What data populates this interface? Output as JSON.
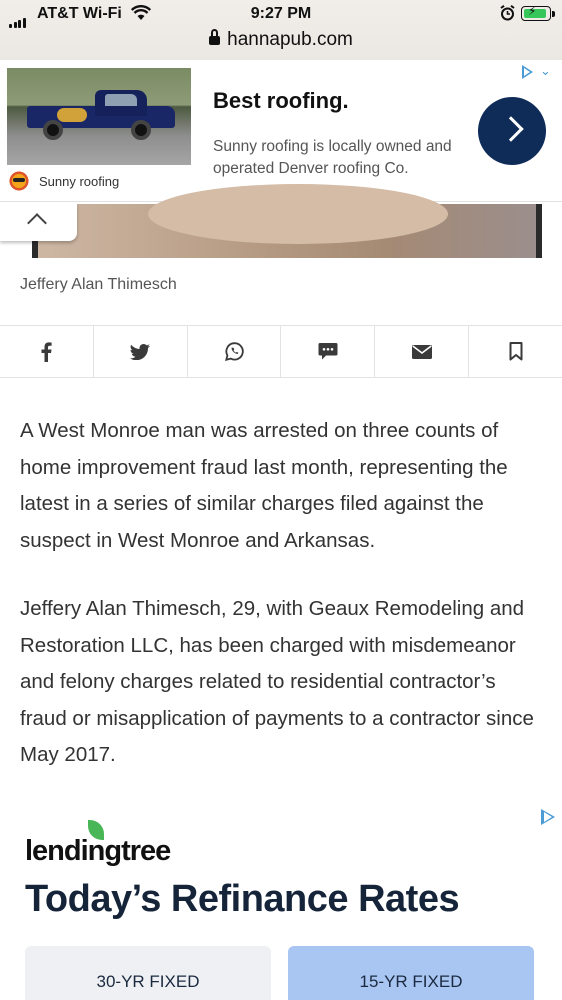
{
  "status_bar": {
    "carrier": "AT&T Wi-Fi",
    "time": "9:27 PM"
  },
  "browser": {
    "url": "hannapub.com"
  },
  "top_ad": {
    "headline": "Best roofing.",
    "description": "Sunny roofing is locally owned and operated Denver roofing Co.",
    "advertiser": "Sunny roofing"
  },
  "photo": {
    "caption": "Jeffery Alan Thimesch"
  },
  "share_bar": {
    "buttons": [
      {
        "name": "facebook",
        "glyph": "f"
      },
      {
        "name": "twitter",
        "glyph": "🐦"
      },
      {
        "name": "whatsapp",
        "glyph": "✆"
      },
      {
        "name": "sms",
        "glyph": "💬"
      },
      {
        "name": "email",
        "glyph": "✉"
      },
      {
        "name": "bookmark",
        "glyph": "🔖"
      }
    ]
  },
  "article": {
    "paragraphs": [
      "A West Monroe man was arrested on three counts of home improvement fraud last month, representing the latest in a series of similar charges filed against the suspect in West Monroe and Arkansas.",
      "Jeffery Alan Thimesch, 29, with Geaux Remodeling and Restoration LLC, has been charged with misdemeanor and felony charges related to residential contractor’s fraud or misapplication of payments to a contractor since May 2017."
    ]
  },
  "bottom_ad": {
    "brand": "lendingtree",
    "title": "Today’s Refinance Rates",
    "tabs": [
      "30-YR FIXED",
      "15-YR FIXED"
    ]
  },
  "colors": {
    "ad_cta": "#0f2c59",
    "adchoices": "#4a9bd6",
    "lendingtree_leaf": "#49b657",
    "active_rate_tab": "#a9c6f2"
  }
}
